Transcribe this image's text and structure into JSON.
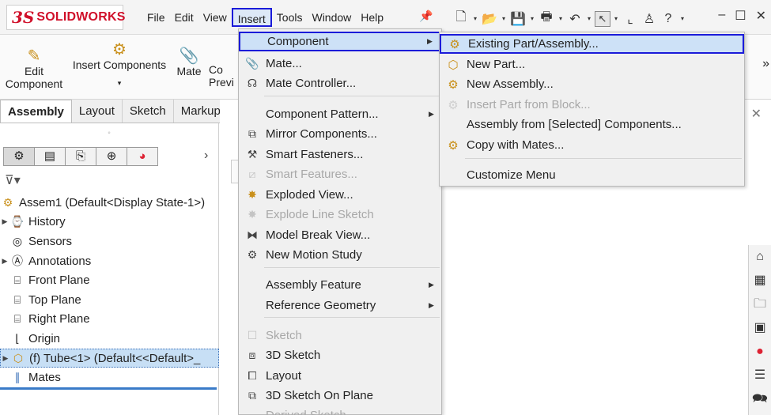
{
  "app": {
    "logo_ds": "3S",
    "logo_word": "SOLIDWORKS"
  },
  "menubar": [
    "File",
    "Edit",
    "View",
    "Insert",
    "Tools",
    "Window",
    "Help"
  ],
  "menubar_active": "Insert",
  "ribbon": {
    "edit_component": [
      "Edit",
      "Component"
    ],
    "insert_components": "Insert Components",
    "mate": "Mate",
    "partial_1": [
      "Co",
      "Previ"
    ],
    "more": "»"
  },
  "tabs": [
    "Assembly",
    "Layout",
    "Sketch",
    "Markup"
  ],
  "tabs_active": "Assembly",
  "tree": {
    "root": "Assem1  (Default<Display State-1>)",
    "items": [
      {
        "label": "History",
        "expandable": true
      },
      {
        "label": "Sensors",
        "expandable": false
      },
      {
        "label": "Annotations",
        "expandable": true
      },
      {
        "label": "Front Plane",
        "expandable": false
      },
      {
        "label": "Top Plane",
        "expandable": false
      },
      {
        "label": "Right Plane",
        "expandable": false
      },
      {
        "label": "Origin",
        "expandable": false
      },
      {
        "label": "(f) Tube<1> (Default<<Default>_",
        "expandable": true
      },
      {
        "label": "Mates",
        "expandable": false
      }
    ]
  },
  "insert_menu": {
    "items": [
      {
        "label": "Component",
        "icon": "",
        "submenu": true,
        "disabled": false
      },
      {
        "label": "Mate...",
        "icon": "paperclip-icon",
        "submenu": false,
        "disabled": false
      },
      {
        "label": "Mate Controller...",
        "icon": "mate-controller-icon",
        "submenu": false,
        "disabled": false
      },
      {
        "label": "Component Pattern...",
        "icon": "",
        "submenu": true,
        "disabled": false
      },
      {
        "label": "Mirror Components...",
        "icon": "mirror-icon",
        "submenu": false,
        "disabled": false
      },
      {
        "label": "Smart Fasteners...",
        "icon": "fastener-icon",
        "submenu": false,
        "disabled": false
      },
      {
        "label": "Smart Features...",
        "icon": "smart-feature-icon",
        "submenu": false,
        "disabled": true
      },
      {
        "label": "Exploded View...",
        "icon": "explode-icon",
        "submenu": false,
        "disabled": false
      },
      {
        "label": "Explode Line Sketch",
        "icon": "explode-line-icon",
        "submenu": false,
        "disabled": true
      },
      {
        "label": "Model Break View...",
        "icon": "break-view-icon",
        "submenu": false,
        "disabled": false
      },
      {
        "label": "New Motion Study",
        "icon": "motion-icon",
        "submenu": false,
        "disabled": false
      },
      {
        "label": "Assembly Feature",
        "icon": "",
        "submenu": true,
        "disabled": false
      },
      {
        "label": "Reference Geometry",
        "icon": "",
        "submenu": true,
        "disabled": false
      },
      {
        "label": "Sketch",
        "icon": "sketch-icon",
        "submenu": false,
        "disabled": true
      },
      {
        "label": "3D Sketch",
        "icon": "3d-sketch-icon",
        "submenu": false,
        "disabled": false
      },
      {
        "label": "Layout",
        "icon": "layout-icon",
        "submenu": false,
        "disabled": false
      },
      {
        "label": "3D Sketch On Plane",
        "icon": "3d-sketch-plane-icon",
        "submenu": false,
        "disabled": false
      },
      {
        "label": "Derived Sketch",
        "icon": "",
        "submenu": false,
        "disabled": true
      }
    ]
  },
  "component_submenu": {
    "items": [
      {
        "label": "Existing Part/Assembly...",
        "icon": "existing-part-icon",
        "disabled": false
      },
      {
        "label": "New Part...",
        "icon": "new-part-icon",
        "disabled": false
      },
      {
        "label": "New Assembly...",
        "icon": "new-assembly-icon",
        "disabled": false
      },
      {
        "label": "Insert Part from Block...",
        "icon": "block-icon",
        "disabled": true
      },
      {
        "label": "Assembly from [Selected] Components...",
        "icon": "",
        "disabled": false
      },
      {
        "label": "Copy with Mates...",
        "icon": "copy-mates-icon",
        "disabled": false
      },
      {
        "label": "Customize Menu",
        "icon": "",
        "disabled": false
      }
    ]
  }
}
